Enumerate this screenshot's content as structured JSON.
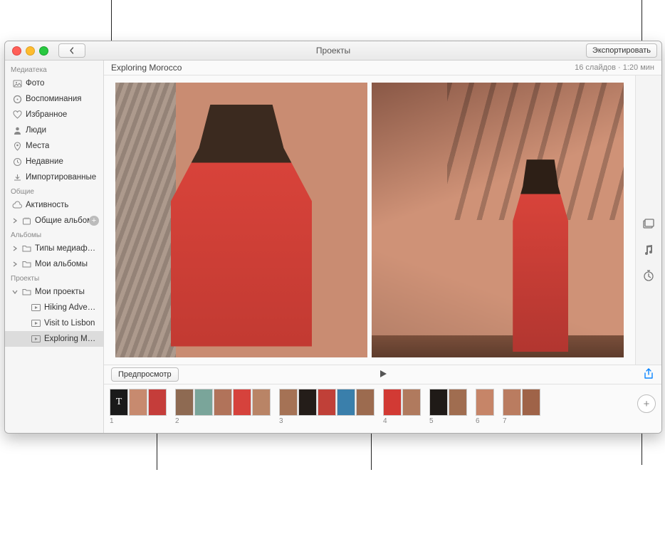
{
  "window": {
    "title": "Проекты",
    "export_label": "Экспортировать"
  },
  "project": {
    "title": "Exploring Morocco",
    "status": "16 слайдов · 1:20 мин"
  },
  "sidebar": {
    "sections": {
      "library": "Медиатека",
      "shared": "Общие",
      "albums": "Альбомы",
      "projects": "Проекты"
    },
    "library_items": {
      "photos": "Фото",
      "memories": "Воспоминания",
      "favorites": "Избранное",
      "people": "Люди",
      "places": "Места",
      "recent": "Недавние",
      "imported": "Импортированные"
    },
    "shared_items": {
      "activity": "Активность",
      "shared_albums": "Общие альбомы"
    },
    "album_items": {
      "media_types": "Типы медиафайлов",
      "my_albums": "Мои альбомы"
    },
    "project_items": {
      "my_projects": "Мои проекты",
      "p1": "Hiking Adventure",
      "p2": "Visit to Lisbon",
      "p3": "Exploring Moroc…"
    }
  },
  "controls": {
    "preview": "Предпросмотр"
  },
  "filmstrip": {
    "title_letter": "T",
    "nums": {
      "n1": "1",
      "n2": "2",
      "n3": "3",
      "n4": "4",
      "n5": "5",
      "n6": "6",
      "n7": "7"
    }
  }
}
